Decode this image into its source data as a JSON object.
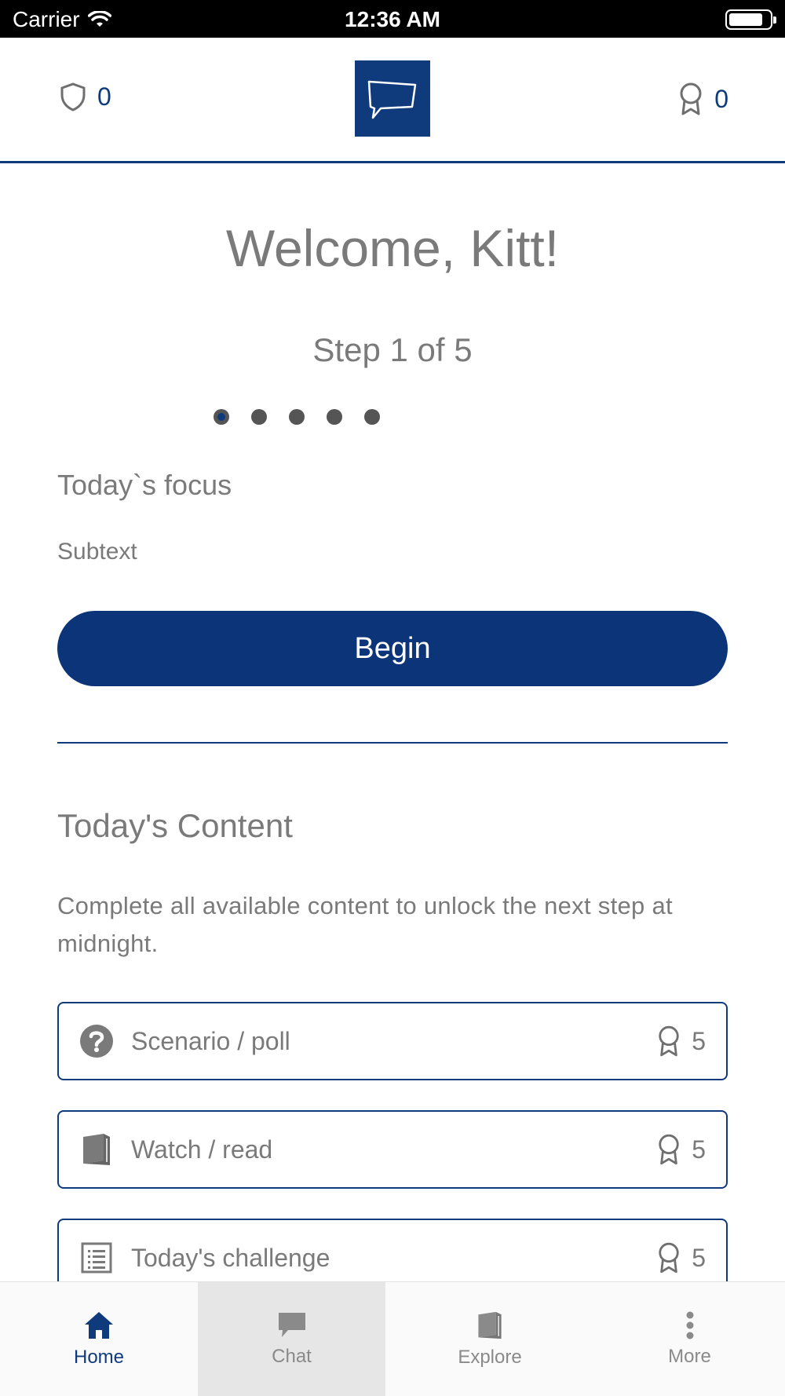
{
  "status_bar": {
    "carrier": "Carrier",
    "time": "12:36 AM"
  },
  "header": {
    "shield_count": "0",
    "award_count": "0"
  },
  "welcome": "Welcome, Kitt!",
  "step": "Step 1 of 5",
  "progress": {
    "current_step": 1,
    "total_steps": 5
  },
  "focus": {
    "title": "Today`s focus",
    "subtext": "Subtext"
  },
  "begin_label": "Begin",
  "content": {
    "title": "Today's Content",
    "description": "Complete all available content to unlock the next step at midnight.",
    "items": [
      {
        "label": "Scenario / poll",
        "points": "5",
        "icon": "question-circle-icon"
      },
      {
        "label": "Watch / read",
        "points": "5",
        "icon": "book-icon"
      },
      {
        "label": "Today's challenge",
        "points": "5",
        "icon": "list-icon"
      }
    ]
  },
  "tabs": [
    {
      "label": "Home",
      "icon": "home-icon"
    },
    {
      "label": "Chat",
      "icon": "chat-icon"
    },
    {
      "label": "Explore",
      "icon": "book-icon"
    },
    {
      "label": "More",
      "icon": "more-vertical-icon"
    }
  ],
  "colors": {
    "brand": "#0f3a7c",
    "text": "#7a7a7a",
    "tab_active_bg": "#e6e6e6"
  }
}
